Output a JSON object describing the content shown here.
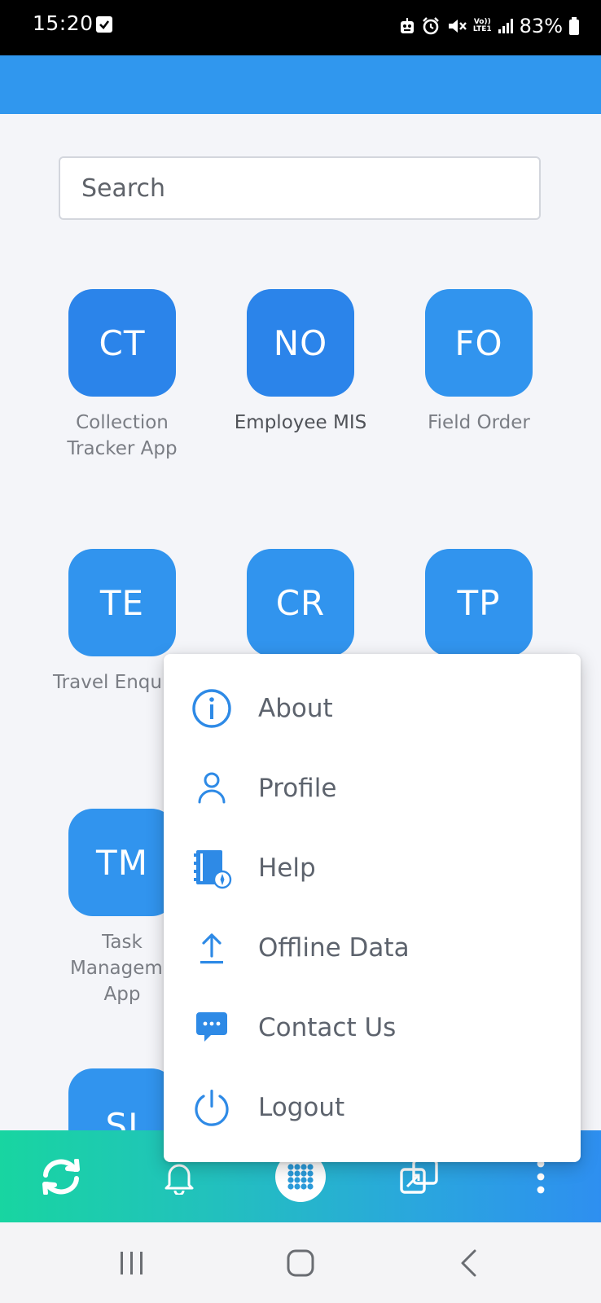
{
  "status_bar": {
    "time": "15:20",
    "volte_top": "Vo))",
    "volte_bottom": "LTE1",
    "battery": "83%"
  },
  "search": {
    "placeholder": "Search"
  },
  "apps": [
    {
      "initials": "CT",
      "label_lines": [
        "Collection",
        "Tracker App"
      ]
    },
    {
      "initials": "NO",
      "label_lines": [
        "Employee MIS"
      ]
    },
    {
      "initials": "FO",
      "label_lines": [
        "Field Order"
      ]
    },
    {
      "initials": "TE",
      "label_lines": [
        "Travel Enqu"
      ]
    },
    {
      "initials": "CR",
      "label_lines": []
    },
    {
      "initials": "TP",
      "label_lines": []
    },
    {
      "initials": "TM",
      "label_lines": [
        "Task",
        "Manageme",
        "App"
      ]
    },
    {
      "initials": "SI",
      "label_lines": []
    }
  ],
  "menu": {
    "items": [
      {
        "label": "About",
        "icon": "info-icon"
      },
      {
        "label": "Profile",
        "icon": "person-icon"
      },
      {
        "label": "Help",
        "icon": "help-book-icon"
      },
      {
        "label": "Offline Data",
        "icon": "upload-icon"
      },
      {
        "label": "Contact Us",
        "icon": "chat-icon"
      },
      {
        "label": "Logout",
        "icon": "power-icon"
      }
    ]
  },
  "bottom_bar": {
    "items": [
      "sync-icon",
      "bell-icon",
      "apps-grid-icon",
      "switch-windows-icon",
      "more-vertical-icon"
    ]
  },
  "nav_bar": {
    "items": [
      "recents-icon",
      "home-icon",
      "back-icon"
    ]
  },
  "colors": {
    "header": "#3097ee",
    "tile_primary": "#2b84ea",
    "tile_secondary": "#3194ee",
    "menu_icon": "#2e8ae6",
    "menu_text": "#5d636d"
  }
}
